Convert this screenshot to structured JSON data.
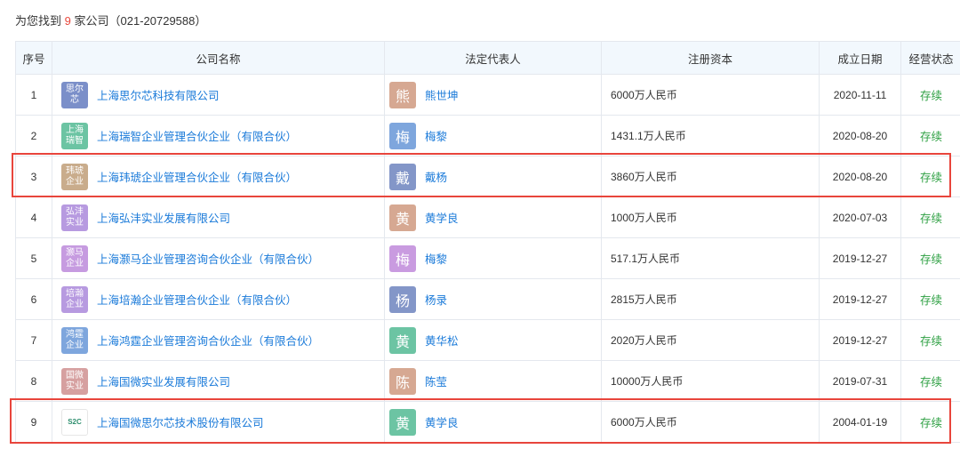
{
  "summary": {
    "prefix": "为您找到",
    "count": "9",
    "suffix": "家公司（021-20729588）"
  },
  "headers": {
    "index": "序号",
    "company": "公司名称",
    "representative": "法定代表人",
    "capital": "注册资本",
    "date": "成立日期",
    "status": "经营状态"
  },
  "rows": [
    {
      "index": "1",
      "logo_text": "思尔芯",
      "logo_color": "#7b8fc9",
      "company": "上海思尔芯科技有限公司",
      "avatar": "熊",
      "avatar_color": "#d6a892",
      "rep": "熊世坤",
      "capital": "6000万人民币",
      "date": "2020-11-11",
      "status": "存续"
    },
    {
      "index": "2",
      "logo_text": "上海瑞智",
      "logo_color": "#6cc4a3",
      "company": "上海瑞智企业管理合伙企业（有限合伙）",
      "avatar": "梅",
      "avatar_color": "#7ea6dd",
      "rep": "梅黎",
      "capital": "1431.1万人民币",
      "date": "2020-08-20",
      "status": "存续"
    },
    {
      "index": "3",
      "logo_text": "玮琥企业",
      "logo_color": "#c9ac8c",
      "company": "上海玮琥企业管理合伙企业（有限合伙）",
      "avatar": "戴",
      "avatar_color": "#8396c8",
      "rep": "戴杨",
      "capital": "3860万人民币",
      "date": "2020-08-20",
      "status": "存续"
    },
    {
      "index": "4",
      "logo_text": "弘沣实业",
      "logo_color": "#b79ae0",
      "company": "上海弘沣实业发展有限公司",
      "avatar": "黄",
      "avatar_color": "#d6a892",
      "rep": "黄学良",
      "capital": "1000万人民币",
      "date": "2020-07-03",
      "status": "存续"
    },
    {
      "index": "5",
      "logo_text": "灏马企业",
      "logo_color": "#c69be0",
      "company": "上海灏马企业管理咨询合伙企业（有限合伙）",
      "avatar": "梅",
      "avatar_color": "#c99be0",
      "rep": "梅黎",
      "capital": "517.1万人民币",
      "date": "2019-12-27",
      "status": "存续"
    },
    {
      "index": "6",
      "logo_text": "培瀚企业",
      "logo_color": "#b79ae0",
      "company": "上海培瀚企业管理合伙企业（有限合伙）",
      "avatar": "杨",
      "avatar_color": "#8396c8",
      "rep": "杨录",
      "capital": "2815万人民币",
      "date": "2019-12-27",
      "status": "存续"
    },
    {
      "index": "7",
      "logo_text": "鸿霆企业",
      "logo_color": "#7ea6dd",
      "company": "上海鸿霆企业管理咨询合伙企业（有限合伙）",
      "avatar": "黄",
      "avatar_color": "#6cc4a3",
      "rep": "黄华松",
      "capital": "2020万人民币",
      "date": "2019-12-27",
      "status": "存续"
    },
    {
      "index": "8",
      "logo_text": "国微实业",
      "logo_color": "#d6a0a0",
      "company": "上海国微实业发展有限公司",
      "avatar": "陈",
      "avatar_color": "#d6a892",
      "rep": "陈莹",
      "capital": "10000万人民币",
      "date": "2019-07-31",
      "status": "存续"
    },
    {
      "index": "9",
      "logo_text": "S2C",
      "logo_color": "",
      "company": "上海国微思尔芯技术股份有限公司",
      "avatar": "黄",
      "avatar_color": "#6cc4a3",
      "rep": "黄学良",
      "capital": "6000万人民币",
      "date": "2004-01-19",
      "status": "存续"
    }
  ],
  "highlight_color": "#e8453c"
}
